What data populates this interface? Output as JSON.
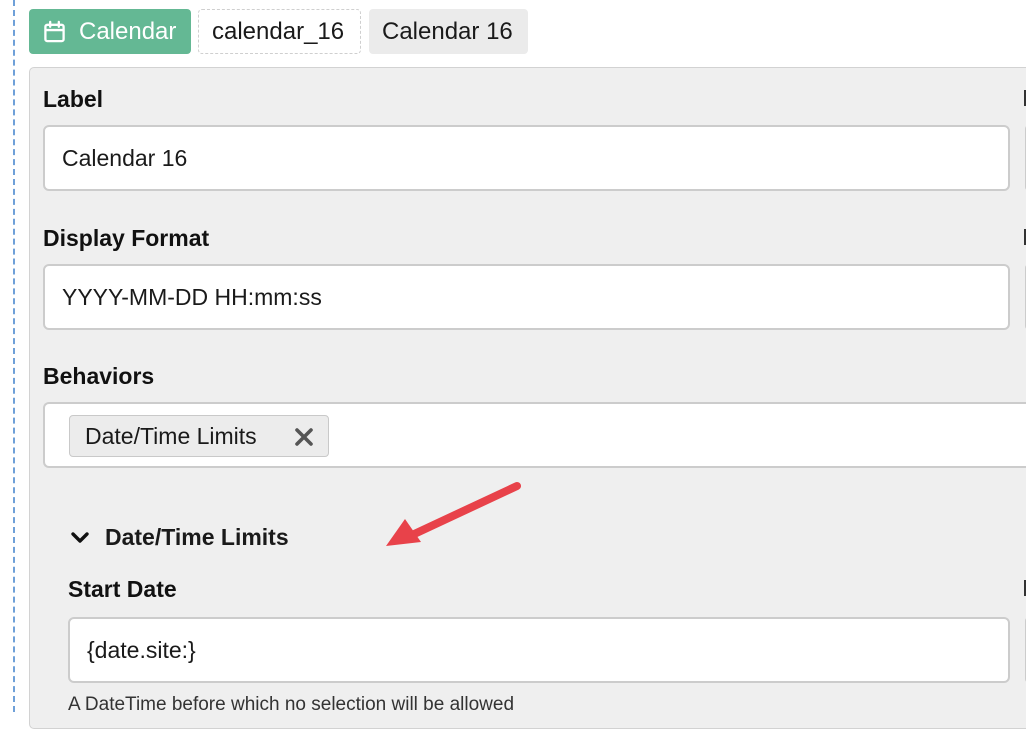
{
  "header": {
    "type_tab": {
      "icon": "calendar-icon",
      "label": "Calendar"
    },
    "id_tab": "calendar_16",
    "name_tab": "Calendar 16"
  },
  "form": {
    "label": {
      "title": "Label",
      "value": "Calendar 16"
    },
    "display_format": {
      "title": "Display Format",
      "value": "YYYY-MM-DD HH:mm:ss"
    },
    "behaviors": {
      "title": "Behaviors",
      "chips": [
        "Date/Time Limits"
      ],
      "remove_icon": "close-icon"
    },
    "section": {
      "title": "Date/Time Limits",
      "toggle_icon": "chevron-down-icon",
      "start_date": {
        "title": "Start Date",
        "value": "{date.site:}",
        "help": "A DateTime before which no selection will be allowed"
      }
    }
  },
  "annotation": {
    "icon": "arrow-icon",
    "color": "#e8424a"
  },
  "colors": {
    "accent": "#64b894",
    "panel": "#efefef",
    "border": "#cccccc"
  }
}
